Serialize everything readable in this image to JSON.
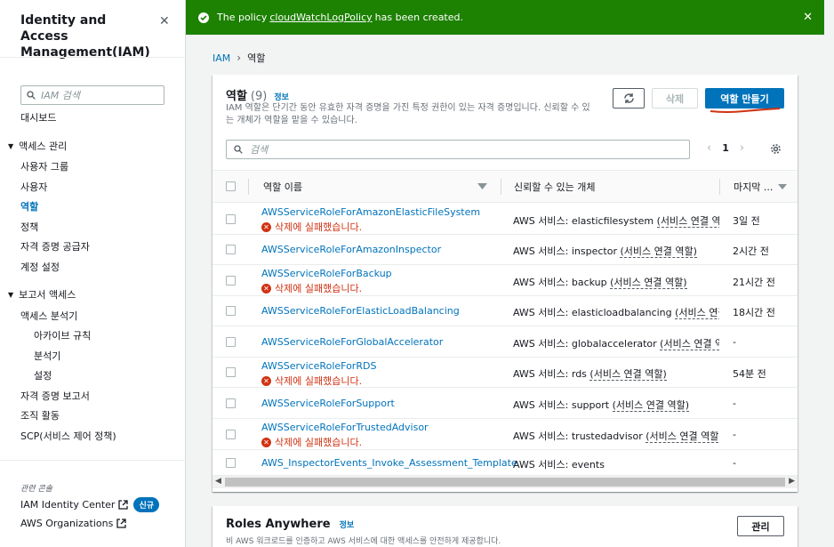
{
  "sidebar": {
    "title": "Identity and Access Management(IAM)",
    "search_placeholder": "IAM 검색",
    "dashboard": "대시보드",
    "access_mgmt_section": "액세스 관리",
    "user_groups": "사용자 그룹",
    "users": "사용자",
    "roles": "역할",
    "policies": "정책",
    "identity_providers": "자격 증명 공급자",
    "account_settings": "계정 설정",
    "reports_section": "보고서 액세스",
    "access_analyzer": "액세스 분석기",
    "archive_rules": "아카이브 규칙",
    "analyzers": "분석기",
    "settings": "설정",
    "credential_report": "자격 증명 보고서",
    "org_activity": "조직 활동",
    "scp": "SCP(서비스 제어 정책)",
    "related_consoles": "관련 콘솔",
    "iam_identity_center": "IAM Identity Center",
    "new_badge": "신규",
    "aws_organizations": "AWS Organizations"
  },
  "flash": {
    "prefix": "The policy",
    "policy_name": "cloudWatchLogPolicy",
    "suffix": "has been created.",
    "color": "#1d8102"
  },
  "breadcrumb": {
    "root": "IAM",
    "current": "역할"
  },
  "roles_panel": {
    "title": "역할",
    "count": "(9)",
    "info": "정보",
    "description": "IAM 역할은 단기간 동안 유효한 자격 증명을 가진 특정 권한이 있는 자격 증명입니다. 신뢰할 수 있는 개체가 역할을 맡을 수 있습니다.",
    "delete_label": "삭제",
    "create_label": "역할 만들기",
    "search_placeholder": "검색",
    "page": "1",
    "col_name": "역할 이름",
    "col_trusted": "신뢰할 수 있는 개체",
    "col_last": "마지막 ..."
  },
  "error_text": "삭제에 실패했습니다.",
  "trusted_prefix": "AWS 서비스:",
  "rows": [
    {
      "name": "AWSServiceRoleForAmazonElasticFileSystem",
      "error": true,
      "service": "elasticfilesystem",
      "linked": "(서비스 연결 역할",
      "last": "3일 전"
    },
    {
      "name": "AWSServiceRoleForAmazonInspector",
      "error": false,
      "service": "inspector",
      "linked": "(서비스 연결 역할)",
      "last": "2시간 전"
    },
    {
      "name": "AWSServiceRoleForBackup",
      "error": true,
      "service": "backup",
      "linked": "(서비스 연결 역할)",
      "last": "21시간 전"
    },
    {
      "name": "AWSServiceRoleForElasticLoadBalancing",
      "error": false,
      "service": "elasticloadbalancing",
      "linked": "(서비스 연결 역",
      "last": "18시간 전"
    },
    {
      "name": "AWSServiceRoleForGlobalAccelerator",
      "error": false,
      "service": "globalaccelerator",
      "linked": "(서비스 연결 역할",
      "last": "-"
    },
    {
      "name": "AWSServiceRoleForRDS",
      "error": true,
      "service": "rds",
      "linked": "(서비스 연결 역할)",
      "last": "54분 전"
    },
    {
      "name": "AWSServiceRoleForSupport",
      "error": false,
      "service": "support",
      "linked": "(서비스 연결 역할)",
      "last": "-"
    },
    {
      "name": "AWSServiceRoleForTrustedAdvisor",
      "error": true,
      "service": "trustedadvisor",
      "linked": "(서비스 연결 역할",
      "last": "-"
    },
    {
      "name": "AWS_InspectorEvents_Invoke_Assessment_Template",
      "error": false,
      "service": "events",
      "linked": "",
      "last": "-"
    }
  ],
  "roles_anywhere": {
    "title": "Roles Anywhere",
    "info": "정보",
    "description": "비 AWS 워크로드를 인증하고 AWS 서비스에 대한 액세스를 안전하게 제공합니다.",
    "manage_label": "관리"
  },
  "colors": {
    "link": "#0073bb",
    "error": "#d13212",
    "primary": "#0073bb"
  }
}
